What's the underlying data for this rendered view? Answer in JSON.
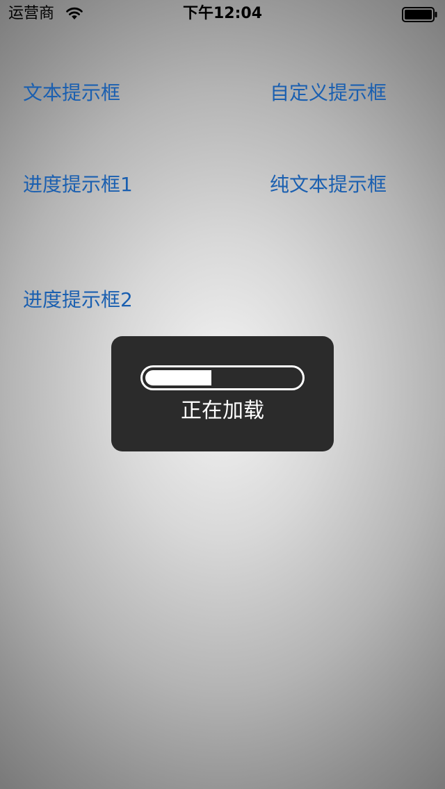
{
  "status_bar": {
    "carrier": "运营商",
    "time": "下午12:04",
    "wifi_icon": "wifi-icon",
    "battery_icon": "battery-full-icon"
  },
  "actions": {
    "text_hud": "文本提示框",
    "custom_hud": "自定义提示框",
    "progress_hud_1": "进度提示框1",
    "plain_text_hud": "纯文本提示框",
    "progress_hud_2": "进度提示框2"
  },
  "hud": {
    "label": "正在加载",
    "progress_fraction": 0.43
  },
  "colors": {
    "link": "#1a5fb0",
    "hud_background": "#2b2b2b"
  }
}
